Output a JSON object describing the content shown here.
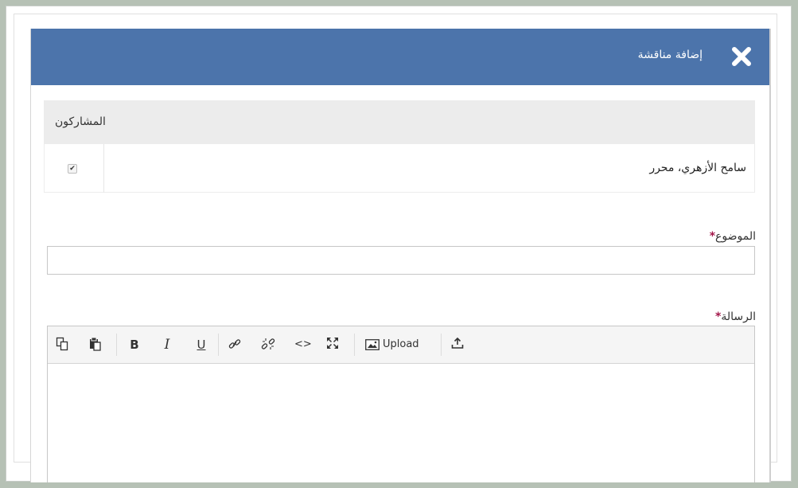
{
  "dialog": {
    "title": "إضافة مناقشة",
    "header_color": "#4c74ab"
  },
  "participants": {
    "header": "المشاركون",
    "rows": [
      {
        "name": "سامح الأزهري، محرر",
        "checked": true
      }
    ]
  },
  "subject": {
    "label": "الموضوع",
    "required_mark": "*",
    "value": ""
  },
  "message": {
    "label": "الرسالة",
    "required_mark": "*"
  },
  "toolbar": {
    "bold": "B",
    "italic": "I",
    "underline": "U",
    "code": "<>",
    "upload_label": "Upload",
    "icons": [
      "copy-icon",
      "paste-icon",
      "bold-icon",
      "italic-icon",
      "underline-icon",
      "link-icon",
      "unlink-icon",
      "code-icon",
      "fullscreen-icon",
      "image-icon",
      "upload-icon"
    ]
  }
}
